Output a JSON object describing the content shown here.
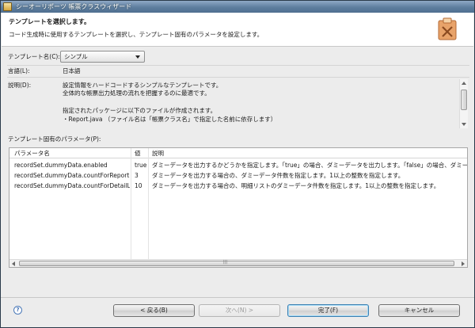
{
  "window": {
    "title": "シーオーリポーツ 帳票クラスウィザード"
  },
  "header": {
    "title": "テンプレートを選択します。",
    "description": "コード生成時に使用するテンプレートを選択し、テンプレート固有のパラメータを設定します。"
  },
  "template": {
    "label": "テンプレート名(C):",
    "value": "シンプル"
  },
  "language": {
    "label": "言語(L):",
    "value": "日本語"
  },
  "description": {
    "label": "説明(D):",
    "lines": [
      "設定情報をハードコードするシンプルなテンプレートです。",
      "全体的な帳票出力処理の流れを把握するのに最適です。",
      "",
      "指定されたパッケージに以下のファイルが作成されます。",
      "・Report.java （ファイル名は「帳票クラス名」で指定した名前に依存します）"
    ]
  },
  "params": {
    "label": "テンプレート固有のパラメータ(P):",
    "columns": [
      "パラメータ名",
      "値",
      "説明"
    ],
    "rows": [
      [
        "recordSet.dummyData.enabled",
        "true",
        "ダミーデータを出力するかどうかを指定します。「true」の場合、ダミーデータを出力します。「false」の場合、ダミーデータ"
      ],
      [
        "recordSet.dummyData.countForReport",
        "3",
        "ダミーデータを出力する場合の、ダミーデータ件数を指定します。1以上の整数を指定します。"
      ],
      [
        "recordSet.dummyData.countForDetailList",
        "10",
        "ダミーデータを出力する場合の、明細リストのダミーデータ件数を指定します。1以上の整数を指定します。"
      ]
    ]
  },
  "buttons": {
    "help": "?",
    "back": "< 戻る(B)",
    "next": "次へ(N) >",
    "finish": "完了(F)",
    "cancel": "キャンセル"
  }
}
